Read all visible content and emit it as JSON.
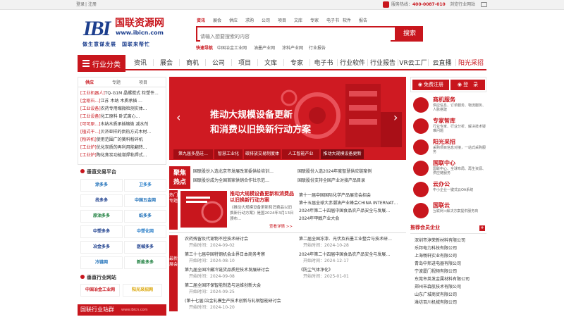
{
  "topbar": {
    "login": "登录",
    "register": "注册",
    "sep": "|",
    "hotline": "服务热线：",
    "phone": "400-0087-010",
    "browse_mobile": "浏览行业网站"
  },
  "logo": {
    "mark": "IBI",
    "cn": "国联资源网",
    "url": "www.ibicn.com",
    "slogan": "做生意谋发展　国联来帮忙"
  },
  "search": {
    "tabs": [
      "资讯",
      "展会",
      "供应",
      "求购",
      "公司",
      "项目",
      "文库",
      "专家",
      "电子书",
      "软件",
      "报告"
    ],
    "placeholder": "请输入想要搜索的内容",
    "button": "搜索"
  },
  "quicknav": {
    "label": "快速导航",
    "items": [
      "中国冶金工业网",
      "油墨产业网",
      "涂料产业网",
      "行业报告"
    ]
  },
  "nav": {
    "category": "行业分类",
    "items": [
      "资讯",
      "展会",
      "商机",
      "公司",
      "项目",
      "文库",
      "专家",
      "电子书",
      "行业软件",
      "行业报告",
      "VR云工厂",
      "云直播",
      "阳光采招"
    ]
  },
  "left_tabs": [
    "供应",
    "专题",
    "项目"
  ],
  "left_list": [
    {
      "tag": "[工业机器人]",
      "text": "TQ-G1M 晶螺搅式 粒塑件..."
    },
    {
      "tag": "[金刚石...]",
      "text": "江苏 木纳 木质承插 ..."
    },
    {
      "tag": "[工业设备]",
      "text": "农药专用缩微检测实体..."
    },
    {
      "tag": "[工业设备]",
      "text": "化工原料 卧式离心..."
    },
    {
      "tag": "[可可原...]",
      "text": "木纳木质承插缩微 减水剂"
    },
    {
      "tag": "[植式干...]",
      "text": "贝济亚样的供热方式木材..."
    },
    {
      "tag": "[粉碎机]",
      "text": "使用范围广的簧料粉碎机"
    },
    {
      "tag": "[工业炉]",
      "text": "优化炭质的再利用能翻转..."
    },
    {
      "tag": "[工业炉]",
      "text": "陶化焦炭功能增焊粘焊式..."
    }
  ],
  "platform": {
    "title": "垂直交易平台",
    "logos": [
      "涂多多",
      "卫多多",
      "找多多",
      "中国五金网",
      "原油多多",
      "纸多多",
      "中塑多多",
      "中塑化网",
      "冶金多多",
      "医械多多",
      "冷链网",
      "新能多多"
    ]
  },
  "industry_net": {
    "title": "垂直行业网站",
    "logos": [
      "中国冶金工业网",
      "阳光采招网"
    ]
  },
  "bottom_bar": {
    "title": "国联行业站群",
    "sub": "www.ibicn.com"
  },
  "banner": {
    "line1": "推动大规模设备更新",
    "line2": "和消费以旧换新行动方案",
    "tabs": [
      "第九届多晶硅…",
      "智慧工业化",
      "碳排放交易制度体系",
      "人工智能产业",
      "推动大规模设备更新"
    ]
  },
  "focus": {
    "label1": "聚焦",
    "label2": "热点",
    "items": [
      "国联股份入选北京市发展改革委供给培训…",
      "国联股份入选2024年度智慧供应链案例",
      "国联股份成为全国首家供销合作社示范…",
      "国联股份支持全国产业对接产品目录"
    ]
  },
  "news_tab": "热门专题",
  "feature": {
    "title": "推动大规模设备更新和消费品以旧换新行动方案",
    "desc": "《推动大规模设备更新和消费品以旧换新行动方案》是国2024年3月13日颁布…",
    "more": "查看详情 >>"
  },
  "right_news": [
    "第十一届中国国际化学产品展览会招会",
    "第十五届全球大赤潮油产业峰会CHINA INTERNAT…",
    "2024年第二十四届中国食品农产品安全与发展…",
    "2024年甲醇产业大会"
  ],
  "expo_label": "最新展会",
  "expo_left": [
    {
      "title": "农药残留及代谢物不控技术研讨会",
      "date": "开始时间：2024-09-02"
    },
    {
      "title": "第三十七届中国特钢机会业界日本商务考察",
      "date": "开始时间：2024-08-10"
    },
    {
      "title": "第九届全国冷藏冷链货品质控技术发展研讨会",
      "date": "开始时间：2024-09-08"
    },
    {
      "title": "第二届全国环保智能制造与运维创新大会",
      "date": "开始时间：2024-09-25"
    },
    {
      "title": "(第十七届)冶金轧模生产技术创新与轧钢智能研讨会",
      "date": "开始时间：2024-10-20"
    }
  ],
  "expo_right": [
    {
      "title": "第二届全国冻漆、光伏及石墨工业整合与技术研…",
      "date": "开始时间：2024-10-28"
    },
    {
      "title": "2024年第二十四届中国食品农产品安全与发展…",
      "date": "开始时间：2024-12-17"
    },
    {
      "title": "《防尘气体净化》",
      "date": "开始时间：2025-01-01"
    }
  ],
  "right_side": {
    "free_reg": "免费注册",
    "login": "登　录",
    "services": [
      {
        "title": "商机服务",
        "desc": "供应信息、订单服务、物流服务、人脉搭建"
      },
      {
        "title": "专家智库",
        "desc": "行业专家、行业分析、解决技术疑难问题"
      },
      {
        "title": "阳光采招",
        "desc": "采购项目信息对接，一站式采购服务"
      },
      {
        "title": "国联中心",
        "desc": "国联中心、全球布局、再生资源、供应链服务"
      },
      {
        "title": "云办公",
        "desc": "中小企业一键式云OA系统"
      },
      {
        "title": "国联云",
        "desc": "互联网+解决方案提供服务商"
      }
    ],
    "recommend_title": "推荐会员企业",
    "recommend": [
      "深圳市淳荣新材料有限公司",
      "乐邦电力科技有限公司",
      "上海畅轩实业有限公司",
      "青岛中邦进电器有限公司",
      "宁波厦门视频有限公司",
      "东莞市英发金属材料有限公司",
      "郑州市森航技术有限公司",
      "山东广城商贸有限公司",
      "潍坊百川机械有限公司"
    ]
  },
  "colors": {
    "brand_red": "#c8161d",
    "brand_blue": "#1d3f8e"
  }
}
